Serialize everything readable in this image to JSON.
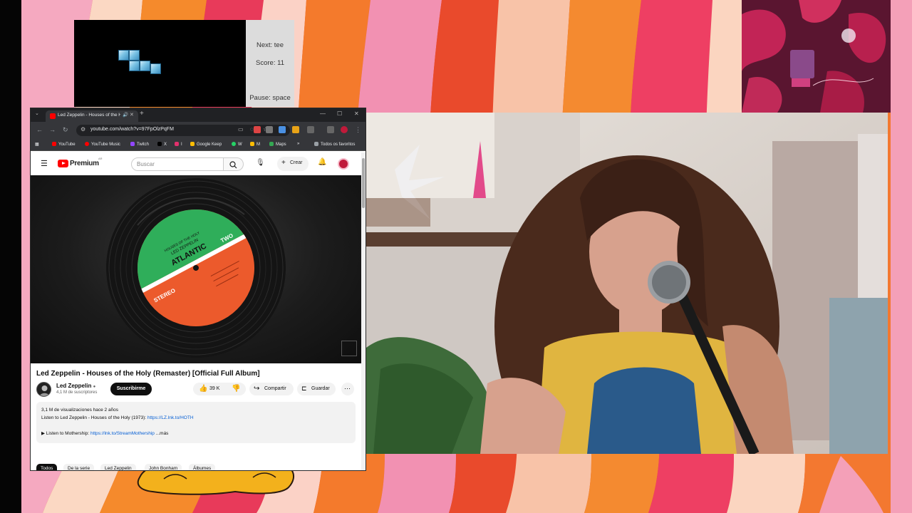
{
  "tetris": {
    "next_label": "Next: tee",
    "score_label": "Score: 11",
    "pause_label": "Pause: space"
  },
  "browser": {
    "tab_title": "Led Zeppelin - Houses of the Holy",
    "url": "youtube.com/watch?v=97FpOlzPqFM",
    "bookmarks": [
      {
        "label": "YouTube",
        "color": "#ff0000"
      },
      {
        "label": "YouTube Music",
        "color": "#ff0000"
      },
      {
        "label": "Twitch",
        "color": "#9146ff"
      },
      {
        "label": "X",
        "color": "#000000"
      },
      {
        "label": "I",
        "color": "#e1306c"
      },
      {
        "label": "Google Keep",
        "color": "#fbbc04"
      },
      {
        "label": "W",
        "color": "#25d366"
      },
      {
        "label": "M",
        "color": "#fbbc04"
      },
      {
        "label": "Maps",
        "color": "#34a853"
      }
    ],
    "all_bookmarks_label": "Todos os favoritos"
  },
  "youtube": {
    "logo_text": "Premium",
    "logo_sup": "AR",
    "search_placeholder": "Buscar",
    "create_label": "Crear",
    "video_title": "Led Zeppelin - Houses of the Holy (Remaster) [Official Full Album]",
    "channel_name": "Led Zeppelin",
    "channel_subs": "4,1 M de suscriptores",
    "subscribe_label": "Suscribirme",
    "likes": "39 K",
    "share_label": "Compartir",
    "save_label": "Guardar",
    "desc_stats": "3,1 M de visualizaciones  hace 2 años",
    "desc_line1_text": "Listen to Led Zeppelin - Houses of the Holy (1973): ",
    "desc_line1_link": "https://LZ.lnk.to/HOTH",
    "desc_line2_text": "▶ Listen to Mothership: ",
    "desc_line2_link": "https://lnk.to/StreamMothership",
    "more_label": "...más",
    "chips": [
      "Todos",
      "De la serie",
      "Led Zeppelin",
      "John Bonham",
      "Álbumes"
    ],
    "label_brand": "ATLANTIC",
    "label_band": "LED ZEPPELIN",
    "label_album": "HOUSES OF THE HOLY",
    "label_side": "TWO",
    "label_format": "STEREO"
  },
  "colors": {
    "youtube_red": "#ff0000",
    "label_green": "#2fae5a",
    "label_orange": "#ec5a2c",
    "link_blue": "#065fd4"
  }
}
